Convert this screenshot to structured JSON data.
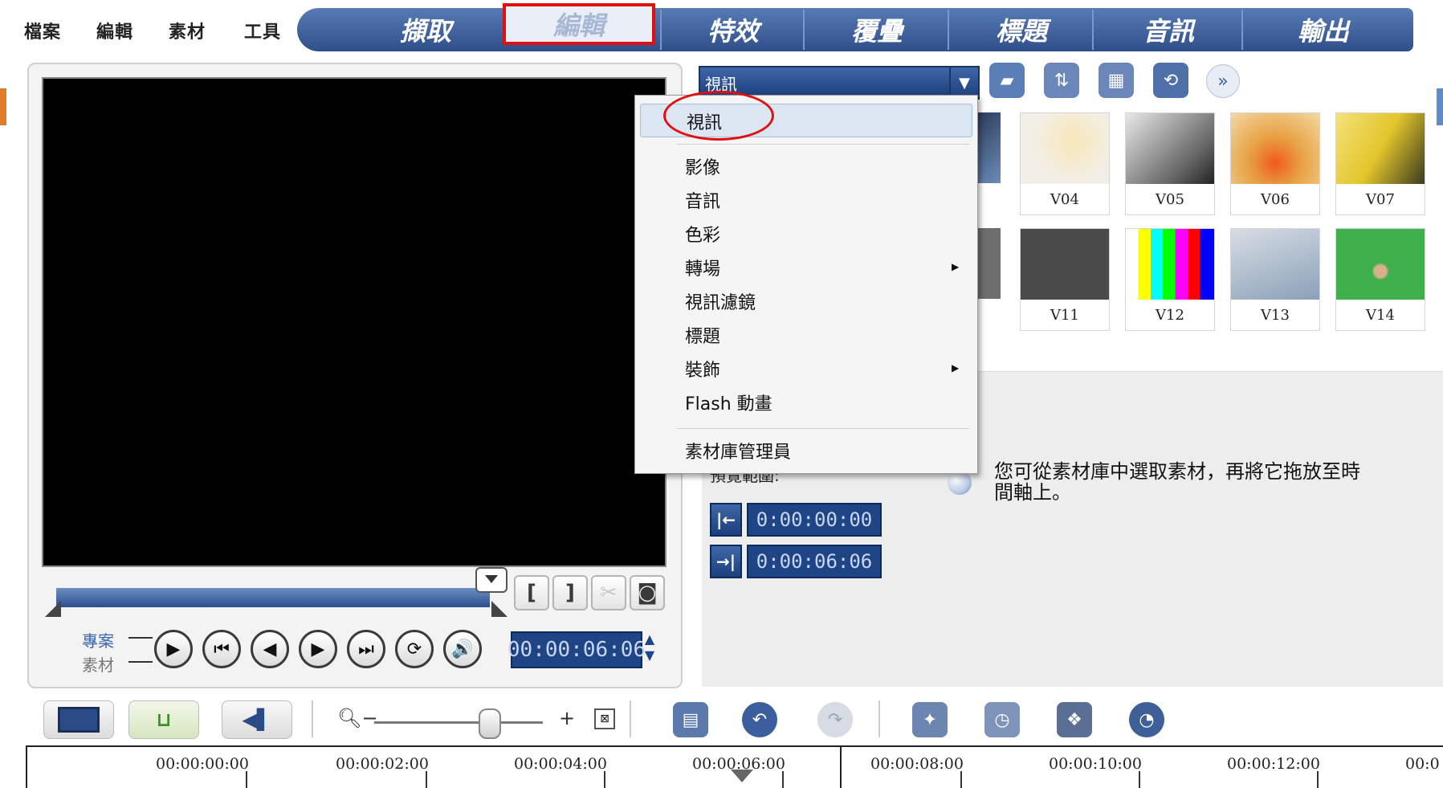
{
  "menu": {
    "items": [
      "檔案",
      "編輯",
      "素材",
      "工具"
    ]
  },
  "tabs": [
    "擷取",
    "編輯",
    "特效",
    "覆疊",
    "標題",
    "音訊",
    "輸出"
  ],
  "selected_tab": "編輯",
  "preview": {
    "mode_project": "專案",
    "mode_clip": "素材",
    "mark_in": "[",
    "mark_out": "]",
    "timecode": "00:00:06:06"
  },
  "library": {
    "combo_value": "視訊",
    "thumbnails": [
      {
        "label": "V04",
        "color": "#f3efe6"
      },
      {
        "label": "V05",
        "color": "#8c8c8c"
      },
      {
        "label": "V06",
        "color": "#e7a143"
      },
      {
        "label": "V07",
        "color": "#e3c52b"
      },
      {
        "label": "V11",
        "color": "#4a4a4a"
      },
      {
        "label": "V12",
        "color": "#9a9a9a"
      },
      {
        "label": "V13",
        "color": "#b5c6d8"
      },
      {
        "label": "V14",
        "color": "#3fb04a"
      }
    ]
  },
  "dropdown": {
    "items": [
      "視訊",
      "影像",
      "音訊",
      "色彩",
      "轉場",
      "視訊濾鏡",
      "標題",
      "裝飾",
      "Flash 動畫",
      "素材庫管理員"
    ],
    "submenu_arrows": [
      "轉場",
      "裝飾"
    ]
  },
  "trim": {
    "range_label": "預覽範圍:",
    "start": "0:00:00:00",
    "end": "0:00:06:06"
  },
  "tip_text": "您可從素材庫中選取素材，再將它拖放至時間軸上。",
  "ruler": [
    "00:00:00:00",
    "00:00:02:00",
    "00:00:04:00",
    "00:00:06:00",
    "00:00:08:00",
    "00:00:10:00",
    "00:00:12:00",
    "00:0"
  ],
  "colors": {
    "accent_blue": "#2f4f8a",
    "selection_red": "#e01010",
    "timecode_bg": "#1f4586"
  }
}
